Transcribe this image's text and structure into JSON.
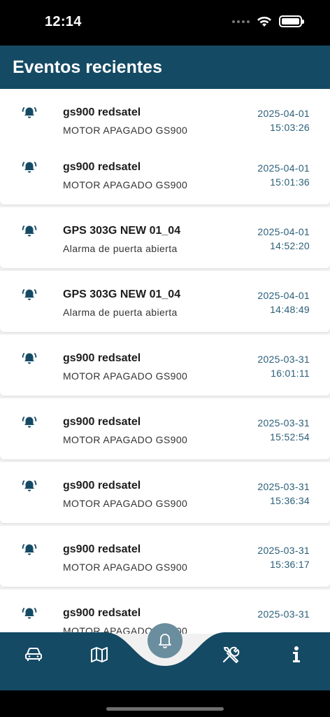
{
  "status_bar": {
    "time": "12:14"
  },
  "header": {
    "title": "Eventos recientes"
  },
  "events": [
    {
      "device": "gs900 redsatel",
      "message": "MOTOR APAGADO GS900",
      "date": "2025-04-01",
      "time": "15:03:26"
    },
    {
      "device": "gs900 redsatel",
      "message": "MOTOR APAGADO GS900",
      "date": "2025-04-01",
      "time": "15:01:36"
    },
    {
      "device": "GPS 303G NEW 01_04",
      "message": "Alarma de puerta abierta",
      "date": "2025-04-01",
      "time": "14:52:20"
    },
    {
      "device": "GPS 303G NEW 01_04",
      "message": "Alarma de puerta abierta",
      "date": "2025-04-01",
      "time": "14:48:49"
    },
    {
      "device": "gs900 redsatel",
      "message": "MOTOR APAGADO GS900",
      "date": "2025-03-31",
      "time": "16:01:11"
    },
    {
      "device": "gs900 redsatel",
      "message": "MOTOR APAGADO GS900",
      "date": "2025-03-31",
      "time": "15:52:54"
    },
    {
      "device": "gs900 redsatel",
      "message": "MOTOR APAGADO GS900",
      "date": "2025-03-31",
      "time": "15:36:34"
    },
    {
      "device": "gs900 redsatel",
      "message": "MOTOR APAGADO GS900",
      "date": "2025-03-31",
      "time": "15:36:17"
    },
    {
      "device": "gs900 redsatel",
      "message": "MOTOR APAGADO GS900",
      "date": "2025-03-31",
      "time": ""
    }
  ],
  "bottom_nav": {
    "items": [
      {
        "icon": "car-icon"
      },
      {
        "icon": "map-icon"
      },
      {
        "icon": "bell-icon",
        "active": true
      },
      {
        "icon": "tools-icon"
      },
      {
        "icon": "info-icon"
      }
    ]
  },
  "colors": {
    "header": "#154a64",
    "accent_text": "#2b5f78",
    "nav_active": "#6b8e9e",
    "card_bg": "#ffffff"
  }
}
